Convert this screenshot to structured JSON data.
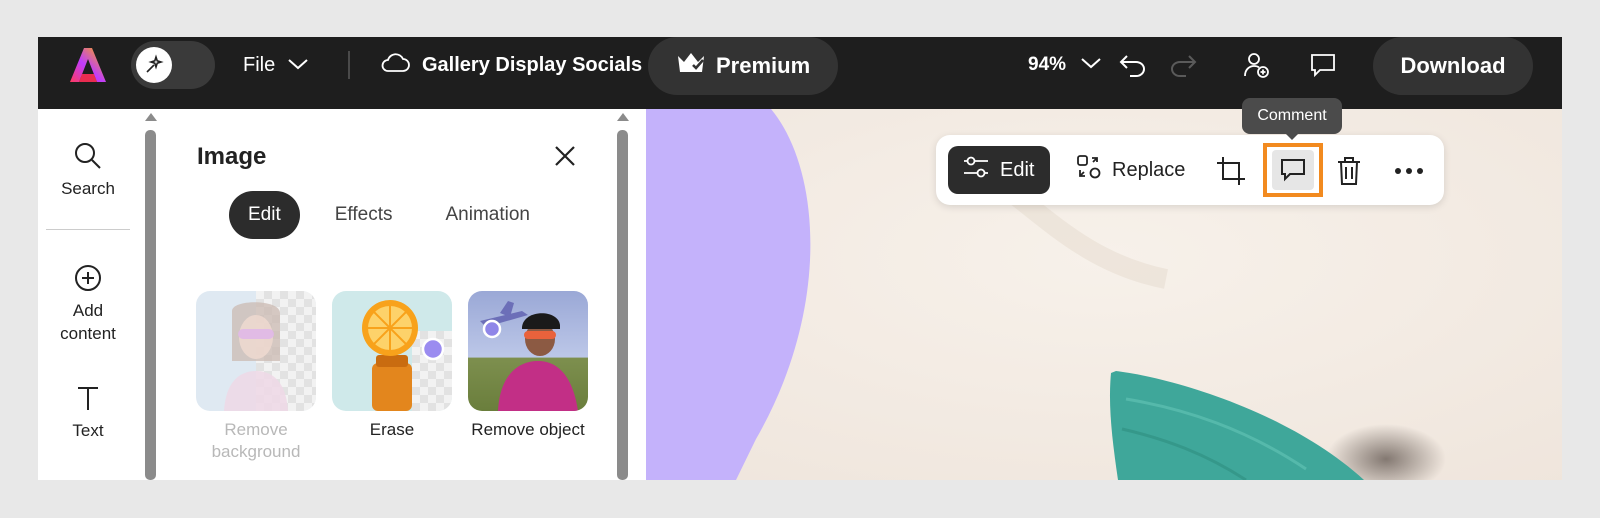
{
  "topbar": {
    "file_label": "File",
    "doc_title": "Gallery Display Socials",
    "premium_label": "Premium",
    "zoom_value": "94%",
    "download_label": "Download"
  },
  "rail": {
    "items": [
      {
        "label": "Search",
        "icon": "search-icon"
      },
      {
        "label": "Add content",
        "icon": "add-content-icon"
      },
      {
        "label": "Text",
        "icon": "text-icon"
      }
    ]
  },
  "panel": {
    "title": "Image",
    "tabs": [
      {
        "label": "Edit",
        "active": true
      },
      {
        "label": "Effects",
        "active": false
      },
      {
        "label": "Animation",
        "active": false
      }
    ],
    "quick_actions": [
      {
        "label": "Remove background",
        "enabled": false
      },
      {
        "label": "Erase",
        "enabled": true
      },
      {
        "label": "Remove object",
        "enabled": true
      }
    ]
  },
  "context_toolbar": {
    "edit_label": "Edit",
    "replace_label": "Replace",
    "tooltip": "Comment"
  },
  "colors": {
    "topbar": "#1e1e1e",
    "highlight": "#f28a1f",
    "canvas": "#f4ece4",
    "purple_shape": "#c4b2fb",
    "teal_shape": "#3fa79a"
  }
}
